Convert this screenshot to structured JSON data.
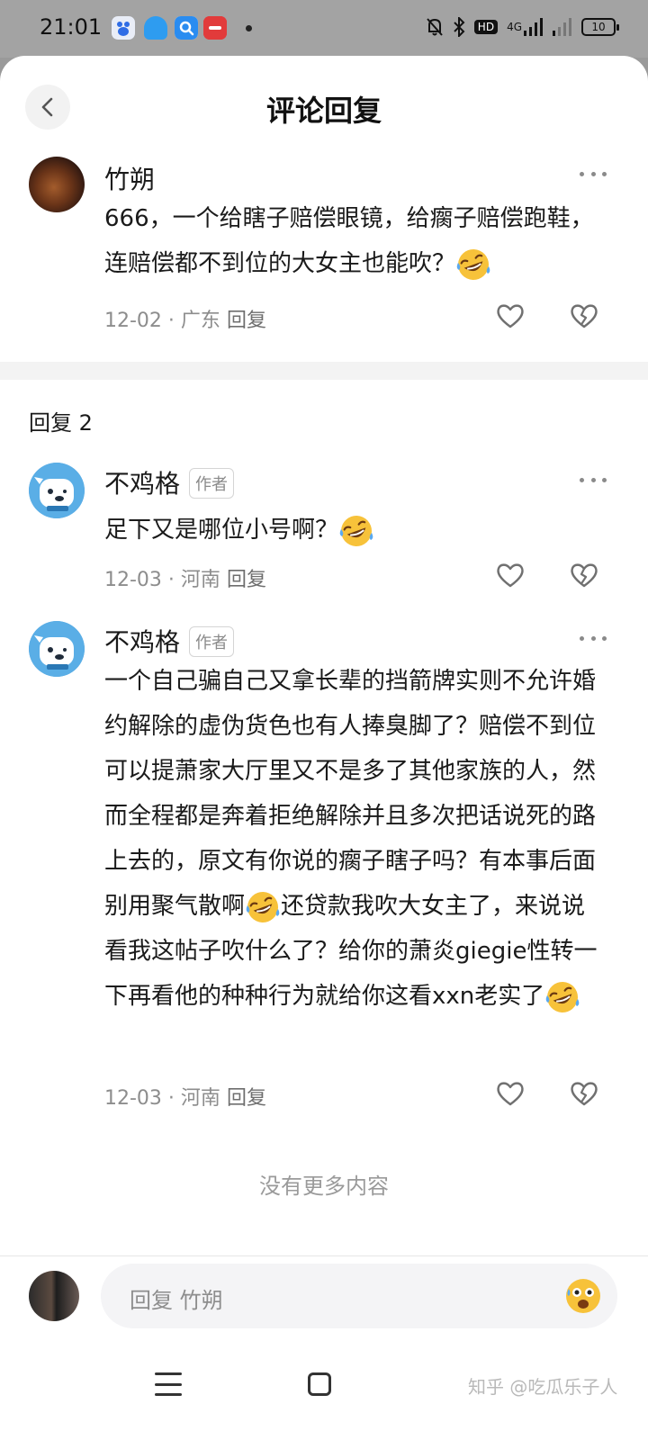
{
  "status_bar": {
    "time": "21:01",
    "app_icons": [
      "baidu-icon",
      "qq-icon",
      "search-app-icon",
      "shopping-app-icon"
    ],
    "network": "4G",
    "network_hd": "HD",
    "battery": "10"
  },
  "header": {
    "title": "评论回复",
    "back_icon": "chevron-left-icon"
  },
  "root_comment": {
    "username": "竹朔",
    "text": "666，一个给瞎子赔偿眼镜，给瘸子赔偿跑鞋，连赔偿都不到位的大女主也能吹？",
    "date": "12-02",
    "location": "广东",
    "reply_label": "回复"
  },
  "replies_header": {
    "label": "回复 2"
  },
  "replies": [
    {
      "username": "不鸡格",
      "author_tag": "作者",
      "text": "足下又是哪位小号啊？",
      "date": "12-03",
      "location": "河南",
      "reply_label": "回复"
    },
    {
      "username": "不鸡格",
      "author_tag": "作者",
      "text_part1": "一个自己骗自己又拿长辈的挡箭牌实则不允许婚约解除的虚伪货色也有人捧臭脚了？赔偿不到位可以提萧家大厅里又不是多了其他家族的人，然而全程都是奔着拒绝解除并且多次把话说死的路上去的，原文有你说的瘸子瞎子吗？有本事后面别用聚气散啊",
      "text_part2": "还贷款我吹大女主了，来说说看我这帖子吹什么了？给你的萧炎giegie性转一下再看他的种种行为就给你这看xxn老实了",
      "date": "12-03",
      "location": "河南",
      "reply_label": "回复"
    }
  ],
  "footer": {
    "no_more": "没有更多内容",
    "reply_placeholder": "回复 竹朔"
  },
  "watermark": "知乎 @吃瓜乐子人",
  "colors": {
    "status_bar_bg": "#a3a3a3",
    "text_primary": "#1a1a1a",
    "text_secondary": "#8d8d8d",
    "divider": "#f3f3f3"
  }
}
